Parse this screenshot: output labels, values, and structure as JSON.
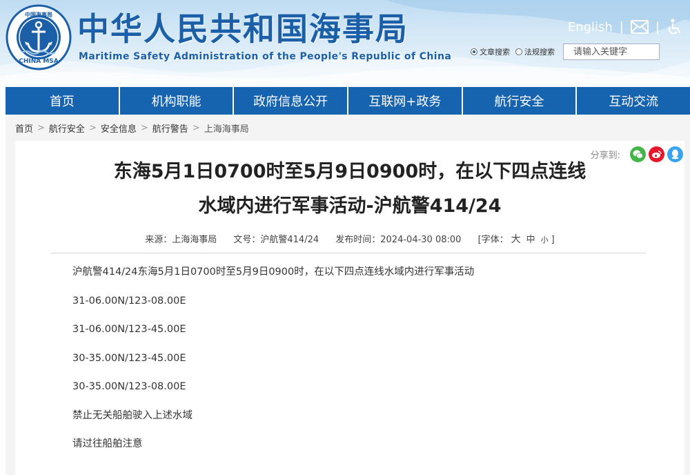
{
  "header": {
    "logo_text": "CHINA MSA",
    "logo_seal_text": "中国海事局",
    "title": "中华人民共和国海事局",
    "subtitle": "Maritime Safety Administration of the People's Republic of China",
    "english_link": "English",
    "separator": "|",
    "mail_icon": "mail-icon",
    "accessibility_icon": "accessibility-icon",
    "search": {
      "radio_article": "文章搜索",
      "radio_regulation": "法规搜索",
      "placeholder": "请输入关键字"
    }
  },
  "nav": {
    "items": [
      {
        "label": "首页"
      },
      {
        "label": "机构职能"
      },
      {
        "label": "政府信息公开"
      },
      {
        "label": "互联网+政务"
      },
      {
        "label": "航行安全"
      },
      {
        "label": "互动交流"
      }
    ]
  },
  "breadcrumb": {
    "items": [
      "首页",
      "航行安全",
      "安全信息",
      "航行警告",
      "上海海事局"
    ],
    "separator": ">"
  },
  "share": {
    "label": "分享到:",
    "icons": [
      "wechat-icon",
      "weibo-icon",
      "qq-icon"
    ],
    "colors": {
      "wechat": "#44b549",
      "weibo": "#e6162d",
      "qq": "#37a3f1"
    }
  },
  "article": {
    "title_line1": "东海5月1日0700时至5月9日0900时，在以下四点连线",
    "title_line2": "水域内进行军事活动-沪航警414/24",
    "meta": {
      "source": "来源：上海海事局",
      "doc_no": "文号：沪航警414/24",
      "published": "发布时间：2024-04-30 08:00",
      "font_label": "[字体：",
      "font_large": "大",
      "font_medium": "中",
      "font_small": "小",
      "font_close": "]"
    },
    "paragraphs": [
      "沪航警414/24东海5月1日0700时至5月9日0900时，在以下四点连线水域内进行军事活动",
      "31-06.00N/123-08.00E",
      "31-06.00N/123-45.00E",
      "30-35.00N/123-45.00E",
      "30-35.00N/123-08.00E",
      "禁止无关船舶驶入上述水域",
      "请过往船舶注意"
    ]
  },
  "colors": {
    "brand_blue": "#1663b0",
    "title_blue": "#1a5fa8"
  }
}
